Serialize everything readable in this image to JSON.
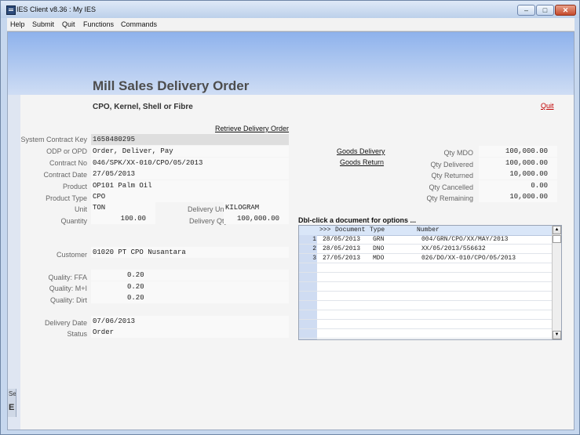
{
  "window": {
    "title": "IES Client v8.36 : My IES",
    "controls": {
      "minimize": "–",
      "maximize": "□",
      "close": "✕"
    }
  },
  "menu": [
    "Help",
    "Submit",
    "Quit",
    "Functions",
    "Commands"
  ],
  "page": {
    "heading": "Mill Sales Delivery Order",
    "subheading": "CPO, Kernel, Shell or Fibre",
    "quit": "Quit",
    "retrieve_link": "Retrieve Delivery Order"
  },
  "form": {
    "system_contract_key": {
      "label": "System Contract Key",
      "value": "1658480295"
    },
    "odp_or_opd": {
      "label": "ODP or OPD",
      "value": "Order, Deliver, Pay"
    },
    "contract_no": {
      "label": "Contract No",
      "value": "046/SPK/XX-010/CPO/05/2013"
    },
    "contract_date": {
      "label": "Contract Date",
      "value": "27/05/2013"
    },
    "product": {
      "label": "Product",
      "value": "OP101 Palm Oil"
    },
    "product_type": {
      "label": "Product Type",
      "value": "CPO"
    },
    "unit": {
      "label": "Unit",
      "value": "TON"
    },
    "quantity": {
      "label": "Quantity",
      "value": "100.00"
    },
    "delivery_unit": {
      "label": "Delivery Unit",
      "value": "KILOGRAM"
    },
    "delivery_qty": {
      "label": "Delivery Qty",
      "value": "100,000.00"
    },
    "customer": {
      "label": "Customer",
      "value": "01020 PT CPO Nusantara"
    },
    "quality_ffa": {
      "label": "Quality: FFA",
      "value": "0.20"
    },
    "quality_mi": {
      "label": "Quality: M+I",
      "value": "0.20"
    },
    "quality_dirt": {
      "label": "Quality: Dirt",
      "value": "0.20"
    },
    "delivery_date": {
      "label": "Delivery Date",
      "value": "07/06/2013"
    },
    "status": {
      "label": "Status",
      "value": "Order"
    }
  },
  "links": {
    "goods_delivery": "Goods Delivery",
    "goods_return": "Goods Return"
  },
  "quantities": {
    "qty_mdo": {
      "label": "Qty MDO",
      "value": "100,000.00"
    },
    "qty_delivered": {
      "label": "Qty Delivered",
      "value": "100,000.00"
    },
    "qty_returned": {
      "label": "Qty Returned",
      "value": "10,000.00"
    },
    "qty_cancelled": {
      "label": "Qty Cancelled",
      "value": "0.00"
    },
    "qty_remaining": {
      "label": "Qty Remaining",
      "value": "10,000.00"
    }
  },
  "documents": {
    "title": "Dbl-click a document for options ...",
    "headers": {
      "marker": ">>>",
      "date": "Document",
      "type": "Type",
      "number": "Number"
    },
    "rows": [
      {
        "n": "1",
        "date": "28/05/2013",
        "type": "GRN",
        "number": "004/GRN/CPO/XX/MAY/2013"
      },
      {
        "n": "2",
        "date": "28/05/2013",
        "type": "DNO",
        "number": "XX/05/2013/556632"
      },
      {
        "n": "3",
        "date": "27/05/2013",
        "type": "MDO",
        "number": "026/DO/XX-010/CPO/05/2013"
      }
    ],
    "scroll_up": "▲",
    "scroll_down": "▼"
  },
  "side_panel": {
    "fragment_top": "Ses",
    "fragment_bottom": "E"
  }
}
